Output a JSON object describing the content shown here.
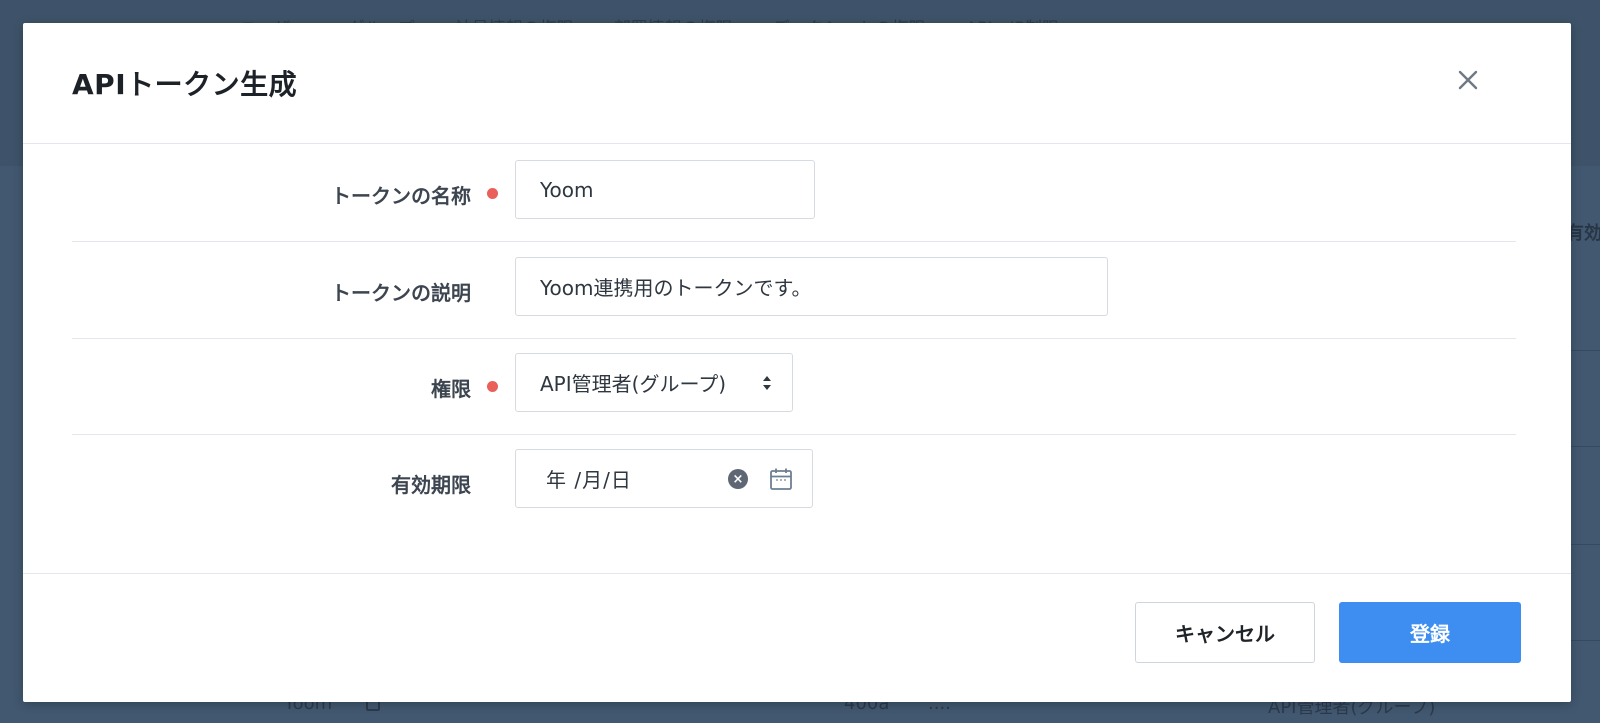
{
  "background": {
    "tabs": [
      "ユーザー",
      "グループ",
      "社員情報の権限",
      "部署情報の権限",
      "データシートの権限",
      "API・IP制限"
    ],
    "column_header": "有効期",
    "row": {
      "name": "Yoom",
      "id": "400a",
      "ellipsis": "....",
      "permission": "API管理者(グループ)"
    }
  },
  "modal": {
    "title": "APIトークン生成",
    "close_icon": "close-icon",
    "fields": {
      "name": {
        "label": "トークンの名称",
        "required": true,
        "value": "Yoom"
      },
      "description": {
        "label": "トークンの説明",
        "required": false,
        "value": "Yoom連携用のトークンです。"
      },
      "permission": {
        "label": "権限",
        "required": true,
        "selected": "API管理者(グループ)"
      },
      "expiry": {
        "label": "有効期限",
        "required": false,
        "placeholder": "年 /月/日"
      }
    },
    "footer": {
      "cancel_label": "キャンセル",
      "submit_label": "登録"
    }
  },
  "colors": {
    "accent": "#3d8ef0",
    "required_dot": "#ea5f5a",
    "overlay": "#3e5369"
  }
}
